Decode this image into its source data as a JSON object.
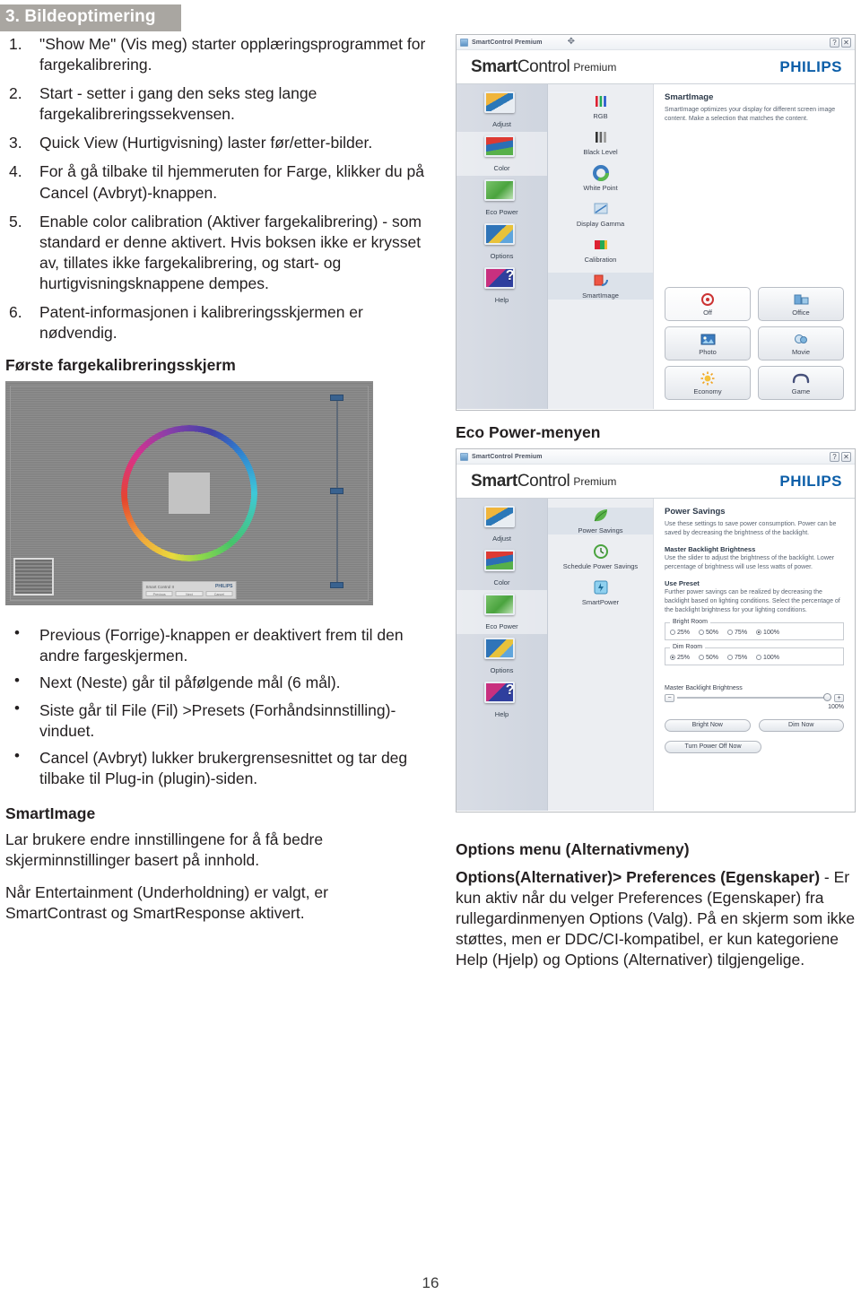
{
  "chapter": {
    "band_title": "3. Bildeoptimering"
  },
  "page_number": "16",
  "left_column": {
    "numbered_items": [
      {
        "num": "1.",
        "text": "\"Show Me\" (Vis meg) starter opplæringsprogrammet for fargekalibrering."
      },
      {
        "num": "2.",
        "text": "Start - setter i gang den seks steg lange fargekalibreringssekvensen."
      },
      {
        "num": "3.",
        "text": "Quick View (Hurtigvisning) laster før/etter-bilder."
      },
      {
        "num": "4.",
        "text": "For å gå tilbake til hjemmeruten for Farge, klikker du på Cancel (Avbryt)-knappen."
      },
      {
        "num": "5.",
        "text": "Enable color calibration (Aktiver fargekalibrering) - som standard er denne aktivert. Hvis boksen ikke er krysset av, tillates ikke fargekalibrering, og start- og hurtigvisningsknappene dempes."
      },
      {
        "num": "6.",
        "text": "Patent-informasjonen i kalibreringsskjermen er nødvendig."
      }
    ],
    "calibration_caption": "Første fargekalibreringsskjerm",
    "bullets": [
      {
        "bullet": "•",
        "text": "Previous (Forrige)-knappen er deaktivert frem til den andre fargeskjermen."
      },
      {
        "bullet": "•",
        "text": "Next (Neste) går til påfølgende mål (6 mål)."
      },
      {
        "bullet": "•",
        "text": "Siste går til File (Fil) >Presets (Forhåndsinnstilling)-vinduet."
      },
      {
        "bullet": "•",
        "text": "Cancel (Avbryt) lukker brukergrensesnittet og tar deg tilbake til Plug-in (plugin)-siden."
      }
    ],
    "smartimage_heading": "SmartImage",
    "smartimage_para1": "Lar brukere endre innstillingene for å få bedre skjerminnstillinger basert på innhold.",
    "smartimage_para2": "Når Entertainment (Underholdning) er valgt, er SmartContrast og SmartResponse aktivert."
  },
  "right_column": {
    "eco_caption": "Eco Power-menyen",
    "options_heading": "Options menu (Alternativmeny)",
    "options_para_bold": "Options(Alternativer)> Preferences (Egenskaper)",
    "options_para_rest": " - Er kun aktiv når du velger Preferences (Egenskaper) fra rullegardinmenyen Options (Valg). På en skjerm som ikke støttes, men er DDC/CI-kompatibel, er kun kategoriene Help (Hjelp) og Options (Alternativer) tilgjengelige."
  },
  "app_window_smartimage": {
    "titlebar": {
      "app_name": "SmartControl Premium",
      "move_glyph": "✥",
      "help_btn": "?",
      "close_btn": "✕"
    },
    "brand": {
      "smart": "Smart",
      "control": "Control",
      "premium": "Premium",
      "philips": "PHILIPS"
    },
    "nav": [
      {
        "label": "Adjust",
        "selected": false
      },
      {
        "label": "Color",
        "selected": true
      },
      {
        "label": "Eco Power",
        "selected": false
      },
      {
        "label": "Options",
        "selected": false
      },
      {
        "label": "Help",
        "selected": false
      }
    ],
    "mid": [
      {
        "label": "RGB",
        "selected": false
      },
      {
        "label": "Black Level",
        "selected": false
      },
      {
        "label": "White Point",
        "selected": false
      },
      {
        "label": "Display Gamma",
        "selected": false
      },
      {
        "label": "Calibration",
        "selected": false
      },
      {
        "label": "SmartImage",
        "selected": true
      }
    ],
    "pane": {
      "heading": "SmartImage",
      "description": "SmartImage optimizes your display for different screen image content. Make a selection that matches the content."
    },
    "presets": [
      {
        "label": "Off",
        "icon": "target-icon",
        "glyph": "◉",
        "active": true
      },
      {
        "label": "Office",
        "icon": "office-icon",
        "glyph": "🗔",
        "active": false
      },
      {
        "label": "Photo",
        "icon": "photo-icon",
        "glyph": "🖼",
        "active": false
      },
      {
        "label": "Movie",
        "icon": "movie-icon",
        "glyph": "🎬",
        "active": false
      },
      {
        "label": "Economy",
        "icon": "sun-icon",
        "glyph": "☀",
        "active": false
      },
      {
        "label": "Game",
        "icon": "gamepad-icon",
        "glyph": "🎮",
        "active": false
      }
    ]
  },
  "app_window_ecopower": {
    "titlebar": {
      "app_name": "SmartControl Premium",
      "help_btn": "?",
      "close_btn": "✕"
    },
    "brand": {
      "smart": "Smart",
      "control": "Control",
      "premium": "Premium",
      "philips": "PHILIPS"
    },
    "nav": [
      {
        "label": "Adjust",
        "selected": false
      },
      {
        "label": "Color",
        "selected": false
      },
      {
        "label": "Eco Power",
        "selected": true
      },
      {
        "label": "Options",
        "selected": false
      },
      {
        "label": "Help",
        "selected": false
      }
    ],
    "mid": [
      {
        "label": "Power Savings",
        "selected": true
      },
      {
        "label": "Schedule Power Savings",
        "selected": false
      },
      {
        "label": "SmartPower",
        "selected": false
      }
    ],
    "pane": {
      "heading": "Power Savings",
      "description": "Use these settings to save power consumption. Power can be saved by decreasing the brightness of the backlight.",
      "sub1_title": "Master Backlight Brightness",
      "sub1_text": "Use the slider to adjust the brightness of the backlight. Lower percentage of brightness will use less watts of power.",
      "sub2_title": "Use Preset",
      "sub2_text": "Further power savings can be realized by decreasing the backlight based on lighting conditions. Select the percentage of the backlight brightness for your lighting conditions."
    },
    "bright_room": {
      "legend": "Bright Room",
      "options": [
        "25%",
        "50%",
        "75%",
        "100%"
      ],
      "selected": "100%"
    },
    "dim_room": {
      "legend": "Dim Room",
      "options": [
        "25%",
        "50%",
        "75%",
        "100%"
      ],
      "selected": "25%"
    },
    "slider": {
      "label": "Master Backlight Brightness",
      "minus": "−",
      "plus": "+",
      "value": "100%"
    },
    "buttons": {
      "bright_now": "Bright Now",
      "dim_now": "Dim Now",
      "turn_power_off_now": "Turn Power Off Now"
    }
  },
  "calibration_screen": {
    "brand_left": "Smart Control II",
    "brand_right": "PHILIPS",
    "buttons": [
      "Previous",
      "Next",
      "Cancel"
    ]
  },
  "colors": {
    "band_bg": "#a9a6a1",
    "philips_blue": "#0b5ea8",
    "text": "#231f20"
  }
}
